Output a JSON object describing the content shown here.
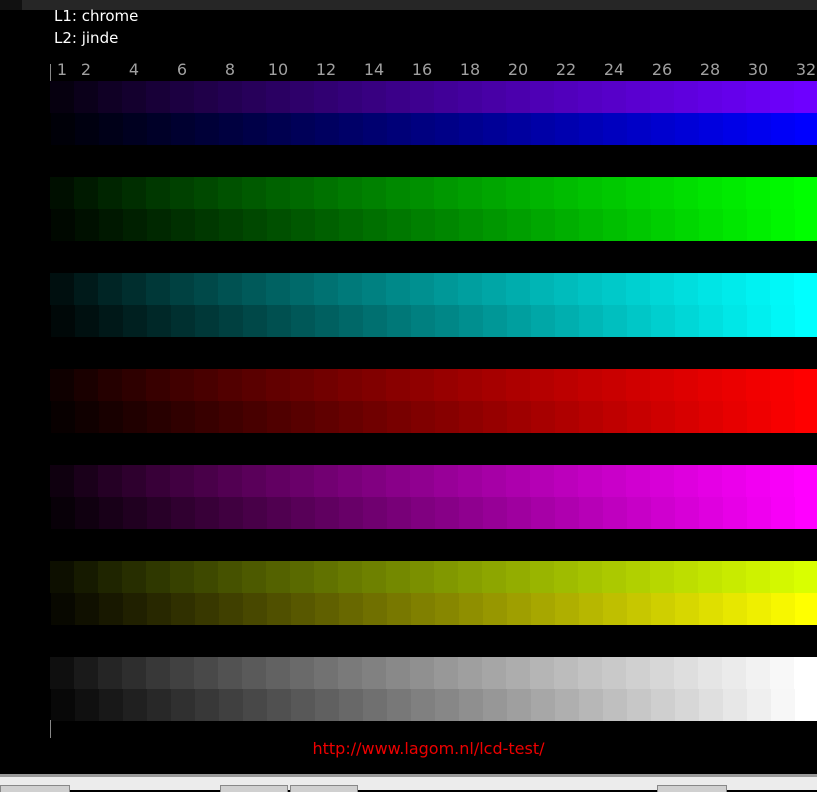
{
  "labels": {
    "l1": "L1: chrome",
    "l2": "L2: jinde"
  },
  "column_numbers": [
    "1",
    "2",
    "4",
    "6",
    "8",
    "10",
    "12",
    "14",
    "16",
    "18",
    "20",
    "22",
    "24",
    "26",
    "28",
    "30",
    "32"
  ],
  "column_indices": [
    1,
    2,
    4,
    6,
    8,
    10,
    12,
    14,
    16,
    18,
    20,
    22,
    24,
    26,
    28,
    30,
    32
  ],
  "column_count": 32,
  "bands": [
    {
      "name": "blue",
      "top": [
        0.43,
        0,
        1
      ],
      "bottom": [
        0,
        0,
        1
      ]
    },
    {
      "name": "green",
      "top": [
        0,
        1,
        0
      ],
      "bottom": [
        0,
        1,
        0
      ]
    },
    {
      "name": "cyan",
      "top": [
        0,
        1,
        1
      ],
      "bottom": [
        0,
        1,
        1
      ]
    },
    {
      "name": "red",
      "top": [
        1,
        0,
        0
      ],
      "bottom": [
        1,
        0,
        0
      ]
    },
    {
      "name": "magenta",
      "top": [
        1,
        0,
        1
      ],
      "bottom": [
        1,
        0,
        1
      ]
    },
    {
      "name": "yellow",
      "top": [
        0.85,
        1,
        0
      ],
      "bottom": [
        1,
        1,
        0
      ]
    },
    {
      "name": "gray",
      "top": [
        1,
        1,
        1
      ],
      "bottom": [
        1,
        1,
        1
      ]
    }
  ],
  "url": "http://www.lagom.nl/lcd-test/"
}
